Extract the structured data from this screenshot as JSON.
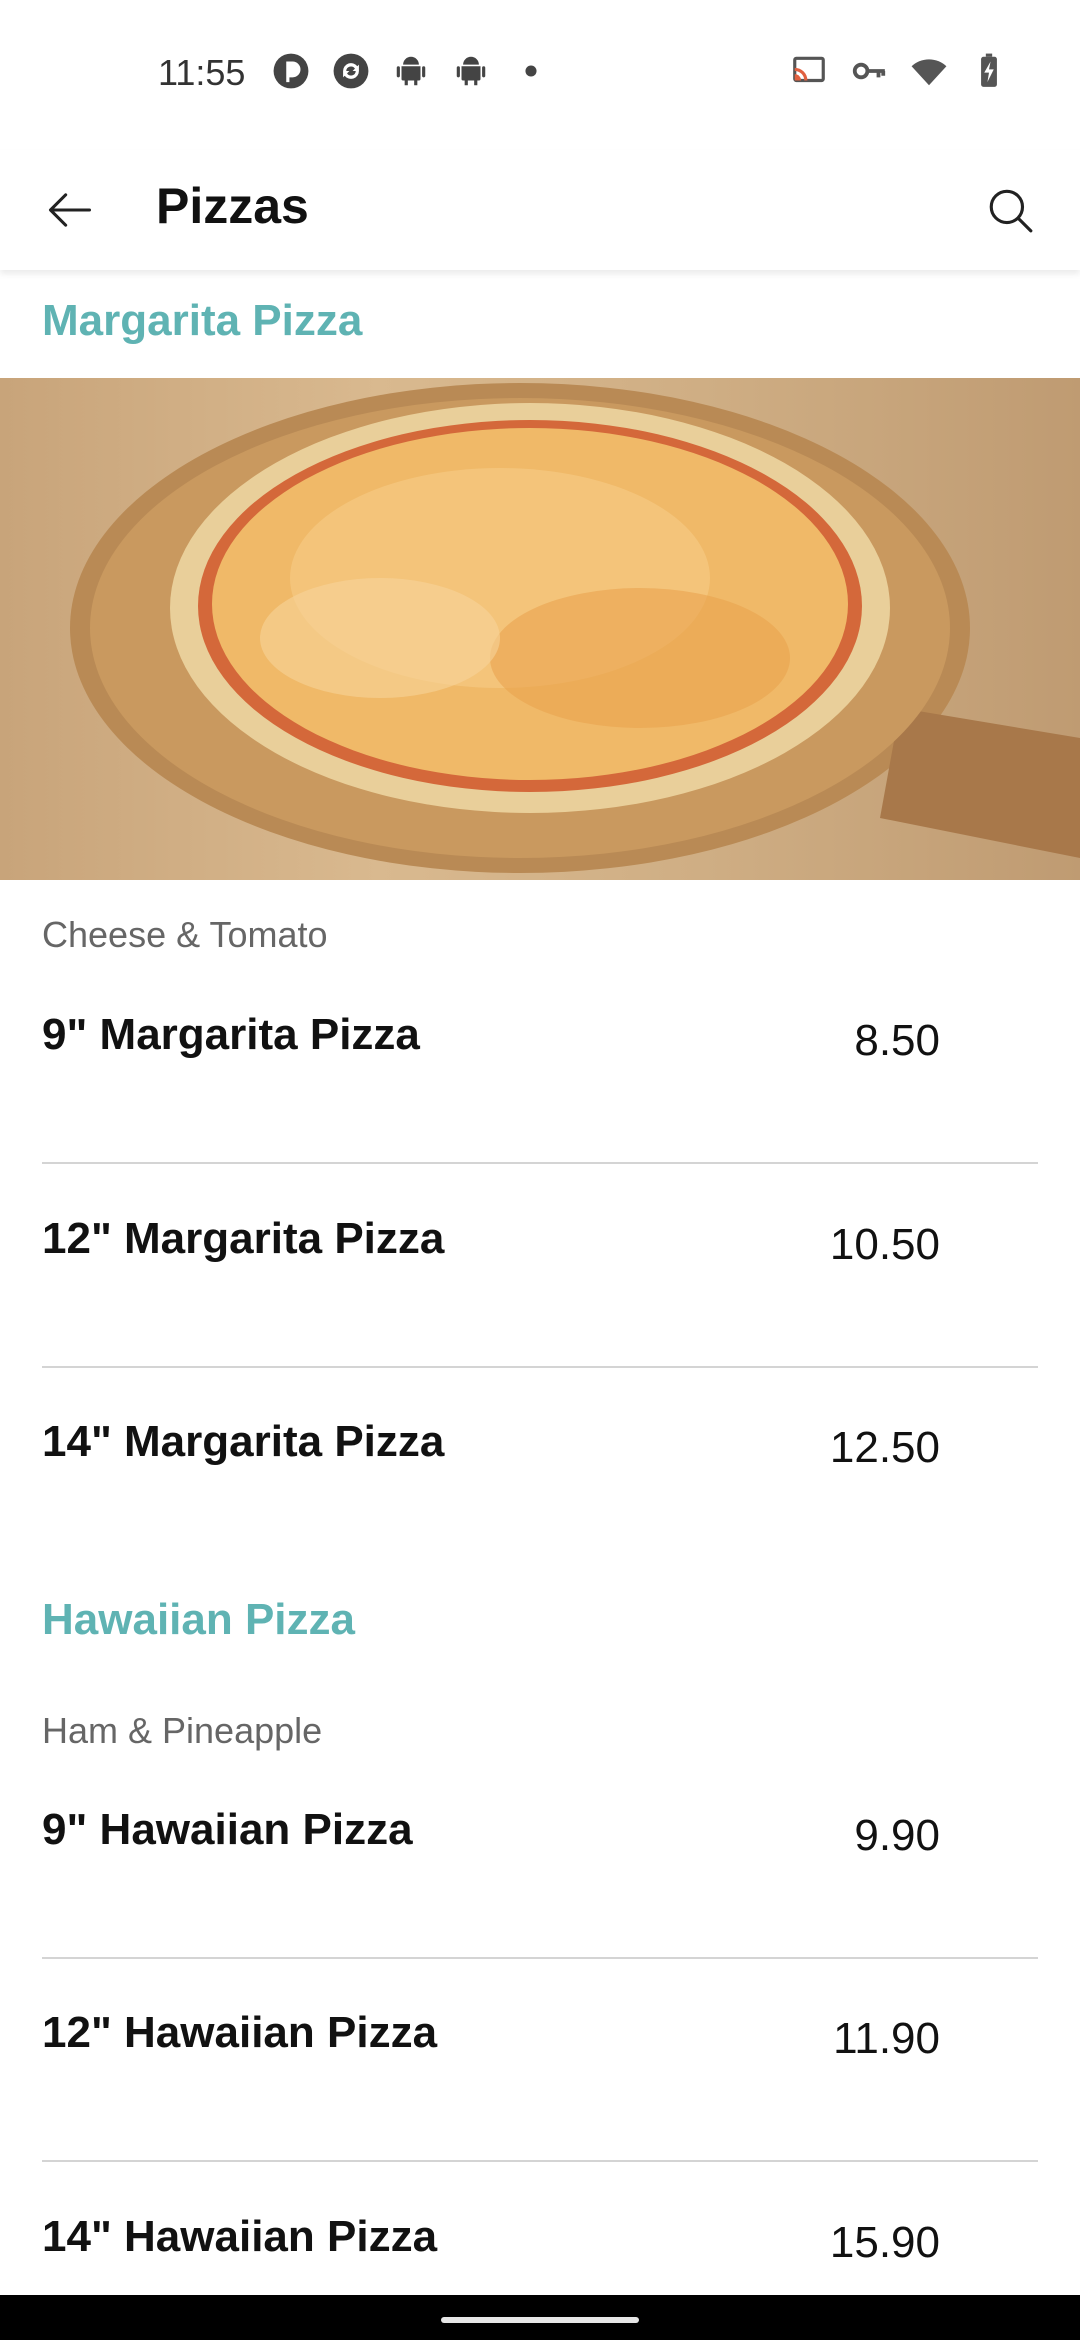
{
  "status_bar": {
    "time": "11:55",
    "left_icons": [
      "pocket-casts-icon",
      "sync-icon",
      "android-icon",
      "android-icon",
      "dot-icon"
    ],
    "right_icons": [
      "cast-icon",
      "vpn-key-icon",
      "wifi-icon",
      "battery-charging-icon"
    ]
  },
  "app_bar": {
    "title": "Pizzas",
    "back_icon": "arrow-left-icon",
    "search_icon": "search-icon"
  },
  "colors": {
    "accent": "#5fb3b3",
    "divider": "#d4d4d4",
    "text": "#111111",
    "subtext": "#666666"
  },
  "sections": [
    {
      "title": "Margarita Pizza",
      "has_image": true,
      "subtitle": "Cheese & Tomato",
      "items": [
        {
          "name": "9\" Margarita Pizza",
          "price": "8.50"
        },
        {
          "name": "12\" Margarita Pizza",
          "price": "10.50"
        },
        {
          "name": "14\" Margarita Pizza",
          "price": "12.50"
        }
      ]
    },
    {
      "title": "Hawaiian Pizza",
      "has_image": false,
      "subtitle": "Ham & Pineapple",
      "items": [
        {
          "name": "9\" Hawaiian Pizza",
          "price": "9.90"
        },
        {
          "name": "12\" Hawaiian Pizza",
          "price": "11.90"
        },
        {
          "name": "14\" Hawaiian Pizza",
          "price": "15.90"
        }
      ]
    }
  ]
}
